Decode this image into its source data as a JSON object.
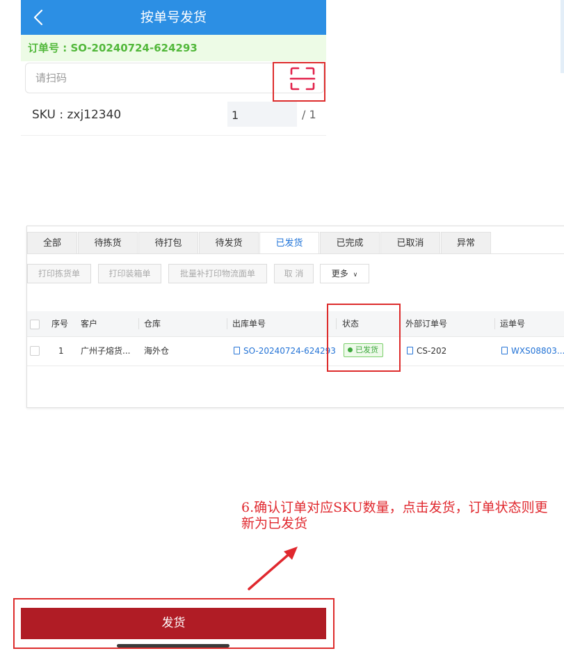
{
  "mobile": {
    "title": "按单号发货",
    "order_number": "订单号 : SO-20240724-624293",
    "scan_placeholder": "请扫码",
    "sku_label": "SKU : zxj12340",
    "qty_value": "1",
    "qty_total": "/ 1",
    "ship_button": "发货"
  },
  "desktop": {
    "tabs": [
      "全部",
      "待拣货",
      "待打包",
      "待发货",
      "已发货",
      "已完成",
      "已取消",
      "异常"
    ],
    "active_tab": "已发货",
    "toolbar": {
      "print_pick_list": "打印拣货单",
      "print_packing_list": "打印装箱单",
      "batch_reprint_label": "批量补打印物流面单",
      "cancel": "取 消",
      "more": "更多"
    },
    "columns": [
      "序号",
      "客户",
      "仓库",
      "出库单号",
      "状态",
      "外部订单号",
      "运单号"
    ],
    "rows": [
      {
        "index": "1",
        "customer": "广州子熔货...",
        "warehouse": "海外仓",
        "outbound_no": "SO-20240724-624293",
        "status": "已发货",
        "external_no": "CS-202",
        "waybill_no": "WXS08803..."
      }
    ]
  },
  "annotation": {
    "text": "6.确认订单对应SKU数量，点击发货，订单状态则更新为已发货"
  },
  "colors": {
    "header_blue": "#2c8fe4",
    "order_green": "#52b83b",
    "ship_red": "#b01c25",
    "highlight_red": "#dd2b2b",
    "link_blue": "#2373d6",
    "status_green": "#3da73d"
  }
}
